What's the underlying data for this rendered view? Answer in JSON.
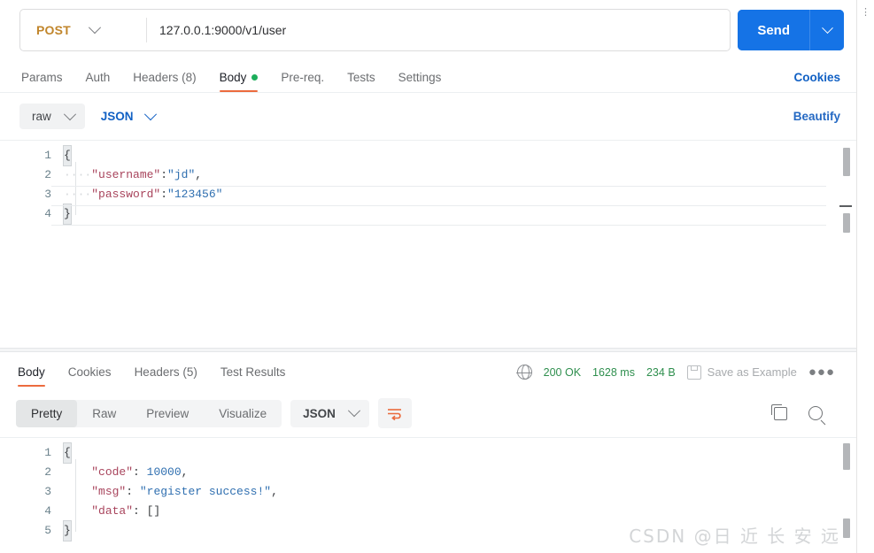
{
  "request": {
    "method": "POST",
    "url": "127.0.0.1:9000/v1/user",
    "send_label": "Send",
    "tabs": [
      {
        "label": "Params",
        "active": false
      },
      {
        "label": "Auth",
        "active": false
      },
      {
        "label": "Headers (8)",
        "active": false
      },
      {
        "label": "Body",
        "active": true
      },
      {
        "label": "Pre-req.",
        "active": false
      },
      {
        "label": "Tests",
        "active": false
      },
      {
        "label": "Settings",
        "active": false
      }
    ],
    "cookies_link": "Cookies",
    "body_mode": "raw",
    "body_format": "JSON",
    "beautify": "Beautify",
    "code_lines": [
      {
        "n": "1",
        "content": "{"
      },
      {
        "n": "2",
        "content": "    \"username\":\"jd\","
      },
      {
        "n": "3",
        "content": "    \"password\":\"123456\""
      },
      {
        "n": "4",
        "content": "}"
      }
    ]
  },
  "response": {
    "tabs": [
      {
        "label": "Body",
        "active": true
      },
      {
        "label": "Cookies",
        "active": false
      },
      {
        "label": "Headers (5)",
        "active": false
      },
      {
        "label": "Test Results",
        "active": false
      }
    ],
    "status": "200 OK",
    "time": "1628 ms",
    "size": "234 B",
    "save_as_example": "Save as Example",
    "view_modes": [
      {
        "label": "Pretty",
        "active": true
      },
      {
        "label": "Raw",
        "active": false
      },
      {
        "label": "Preview",
        "active": false
      },
      {
        "label": "Visualize",
        "active": false
      }
    ],
    "format": "JSON",
    "code_lines": [
      {
        "n": "1",
        "content": "{"
      },
      {
        "n": "2",
        "content": "    \"code\": 10000,"
      },
      {
        "n": "3",
        "content": "    \"msg\": \"register success!\","
      },
      {
        "n": "4",
        "content": "    \"data\": []"
      },
      {
        "n": "5",
        "content": "}"
      }
    ]
  },
  "watermark": "CSDN @日 近 长 安 远",
  "colors": {
    "accent_orange": "#ec6b3e",
    "send_blue": "#1573e6",
    "method_gold": "#c1862c",
    "status_green": "#2f8f4e",
    "link_blue": "#1261c4"
  }
}
